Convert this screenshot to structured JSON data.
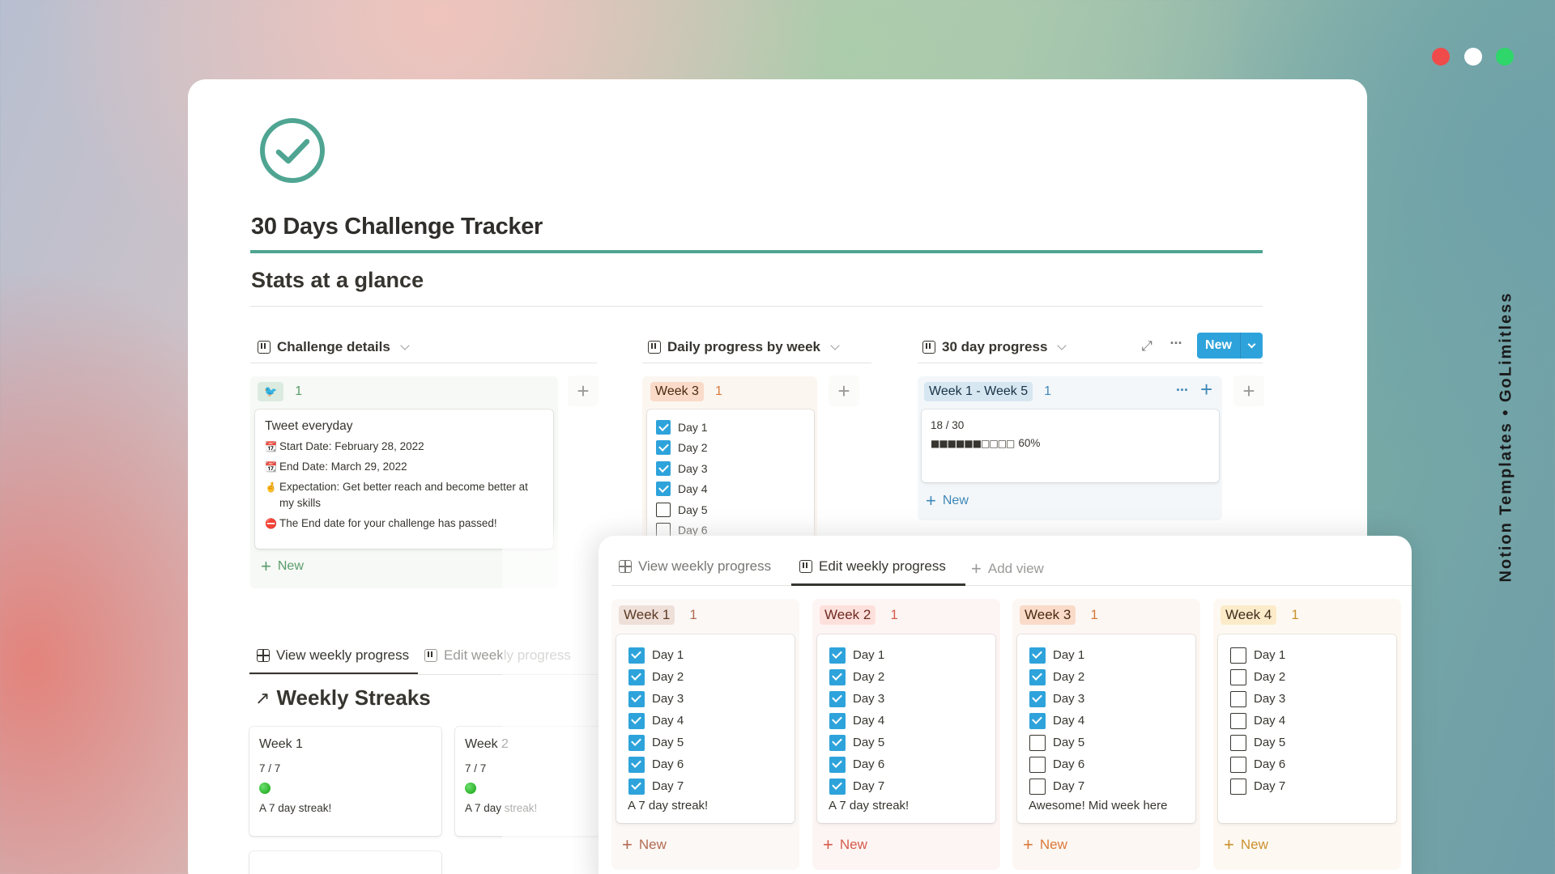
{
  "window_controls": {
    "close_color": "#ef4b4b",
    "minimize_color": "#ffffff",
    "maximize_color": "#2fd66a"
  },
  "watermark": "Notion Templates • GoLimitless",
  "colors": {
    "accent_teal": "#4fa592",
    "checkbox_blue": "#2ea3db",
    "new_button_blue": "#2ea3db"
  },
  "page": {
    "icon": "check-circle-icon",
    "title": "30 Days Challenge Tracker",
    "section_heading": "Stats at a glance"
  },
  "boards": {
    "challenge_details": {
      "title": "Challenge details",
      "group": {
        "tag_icon": "🐦",
        "count": "1"
      },
      "card": {
        "title": "Tweet everyday",
        "properties": [
          {
            "icon": "📆",
            "text": "Start Date: February 28, 2022"
          },
          {
            "icon": "📆",
            "text": "End Date: March 29, 2022"
          },
          {
            "icon": "🤞",
            "text": "Expectation: Get better reach and become better at my skills"
          },
          {
            "icon": "⛔",
            "text": "The End date for your challenge has passed!"
          }
        ]
      },
      "new_label": "New"
    },
    "daily_progress": {
      "title": "Daily progress by week",
      "group": {
        "tag": "Week 3",
        "count": "1"
      },
      "days": [
        {
          "label": "Day 1",
          "checked": true
        },
        {
          "label": "Day 2",
          "checked": true
        },
        {
          "label": "Day 3",
          "checked": true
        },
        {
          "label": "Day 4",
          "checked": true
        },
        {
          "label": "Day 5",
          "checked": false
        },
        {
          "label": "Day 6",
          "checked": false
        }
      ]
    },
    "thirty_day": {
      "title": "30 day progress",
      "new_button": "New",
      "group": {
        "tag": "Week 1 - Week 5",
        "count": "1"
      },
      "card": {
        "fraction": "18 / 30",
        "progress_percent": 60,
        "progress_bar": "■■■■■■□□□□",
        "progress_label": "60%"
      },
      "new_label": "New"
    }
  },
  "bottom_tabs": {
    "tabs": [
      {
        "label": "View weekly progress",
        "active": true
      },
      {
        "label": "Edit weekly progress",
        "active": false
      }
    ],
    "heading": "Weekly Streaks",
    "cards": [
      {
        "title": "Week 1",
        "fraction": "7 / 7",
        "status": "green",
        "note": "A 7 day streak!"
      },
      {
        "title": "Week 2",
        "fraction": "7 / 7",
        "status": "green",
        "note": "A 7 day streak!"
      }
    ]
  },
  "overlay": {
    "tabs": [
      {
        "label": "View weekly progress",
        "active": false
      },
      {
        "label": "Edit weekly progress",
        "active": true
      }
    ],
    "add_view": "Add view",
    "columns": [
      {
        "tag": "Week 1",
        "count": "1",
        "bg": "#fbf8f6",
        "tag_bg": "#eedfd9",
        "tag_color": "#5c3b23",
        "accent": "#b36b52",
        "days": [
          true,
          true,
          true,
          true,
          true,
          true,
          true
        ],
        "note": "A 7 day streak!",
        "new_label": "New"
      },
      {
        "tag": "Week 2",
        "count": "1",
        "bg": "#fdf5f4",
        "tag_bg": "#fde0dc",
        "tag_color": "#6e2a20",
        "accent": "#d45c4c",
        "days": [
          true,
          true,
          true,
          true,
          true,
          true,
          true
        ],
        "note": "A 7 day streak!",
        "new_label": "New"
      },
      {
        "tag": "Week 3",
        "count": "1",
        "bg": "#fcf7f3",
        "tag_bg": "#fadbc9",
        "tag_color": "#49290e",
        "accent": "#d9793b",
        "days": [
          true,
          true,
          true,
          true,
          false,
          false,
          false
        ],
        "note": "Awesome! Mid week here",
        "new_label": "New"
      },
      {
        "tag": "Week 4",
        "count": "1",
        "bg": "#fdf9f2",
        "tag_bg": "#fcebc9",
        "tag_color": "#402c1b",
        "accent": "#cb912f",
        "days": [
          false,
          false,
          false,
          false,
          false,
          false,
          false
        ],
        "note": "",
        "new_label": "New"
      }
    ],
    "day_labels": [
      "Day 1",
      "Day 2",
      "Day 3",
      "Day 4",
      "Day 5",
      "Day 6",
      "Day 7"
    ]
  }
}
